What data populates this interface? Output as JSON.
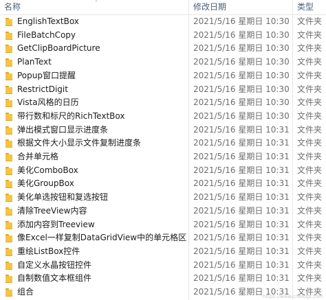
{
  "columns": {
    "name": "名称",
    "date": "修改日期",
    "type": "类型"
  },
  "icons": {
    "folder": "folder-icon",
    "sort": "sort-up-icon"
  },
  "files": [
    {
      "name": "EnglishTextBox",
      "date": "2021/5/16 星期日 10:30",
      "type": "文件夹"
    },
    {
      "name": "FileBatchCopy",
      "date": "2021/5/16 星期日 10:30",
      "type": "文件夹"
    },
    {
      "name": "GetClipBoardPicture",
      "date": "2021/5/16 星期日 10:30",
      "type": "文件夹"
    },
    {
      "name": "PlanText",
      "date": "2021/5/16 星期日 10:30",
      "type": "文件夹"
    },
    {
      "name": "Popup窗口提醒",
      "date": "2021/5/16 星期日 10:30",
      "type": "文件夹"
    },
    {
      "name": "RestrictDigit",
      "date": "2021/5/16 星期日 10:30",
      "type": "文件夹"
    },
    {
      "name": "Vista风格的日历",
      "date": "2021/5/16 星期日 10:30",
      "type": "文件夹"
    },
    {
      "name": "带行数和标尺的RichTextBox",
      "date": "2021/5/16 星期日 10:30",
      "type": "文件夹"
    },
    {
      "name": "弹出模式窗口显示进度条",
      "date": "2021/5/16 星期日 10:31",
      "type": "文件夹"
    },
    {
      "name": "根据文件大小显示文件复制进度条",
      "date": "2021/5/16 星期日 10:31",
      "type": "文件夹"
    },
    {
      "name": "合并单元格",
      "date": "2021/5/16 星期日 10:31",
      "type": "文件夹"
    },
    {
      "name": "美化ComboBox",
      "date": "2021/5/16 星期日 10:31",
      "type": "文件夹"
    },
    {
      "name": "美化GroupBox",
      "date": "2021/5/16 星期日 10:31",
      "type": "文件夹"
    },
    {
      "name": "美化单选按钮和复选按钮",
      "date": "2021/5/16 星期日 10:31",
      "type": "文件夹"
    },
    {
      "name": "清除TreeView内容",
      "date": "2021/5/16 星期日 10:31",
      "type": "文件夹"
    },
    {
      "name": "添加内容到Treeview",
      "date": "2021/5/16 星期日 10:31",
      "type": "文件夹"
    },
    {
      "name": "像Excel一样复制DataGridView中的单元格区域...",
      "date": "2021/5/16 星期日 10:31",
      "type": "文件夹"
    },
    {
      "name": "重绘ListBox控件",
      "date": "2021/5/16 星期日 10:31",
      "type": "文件夹"
    },
    {
      "name": "自定义水晶按钮控件",
      "date": "2021/5/16 星期日 10:31",
      "type": "文件夹"
    },
    {
      "name": "自制数值文本框组件",
      "date": "2021/5/16 星期日 10:31",
      "type": "文件夹"
    },
    {
      "name": "组合",
      "date": "2021/5/16 星期日 10:31",
      "type": "文件夹"
    }
  ]
}
